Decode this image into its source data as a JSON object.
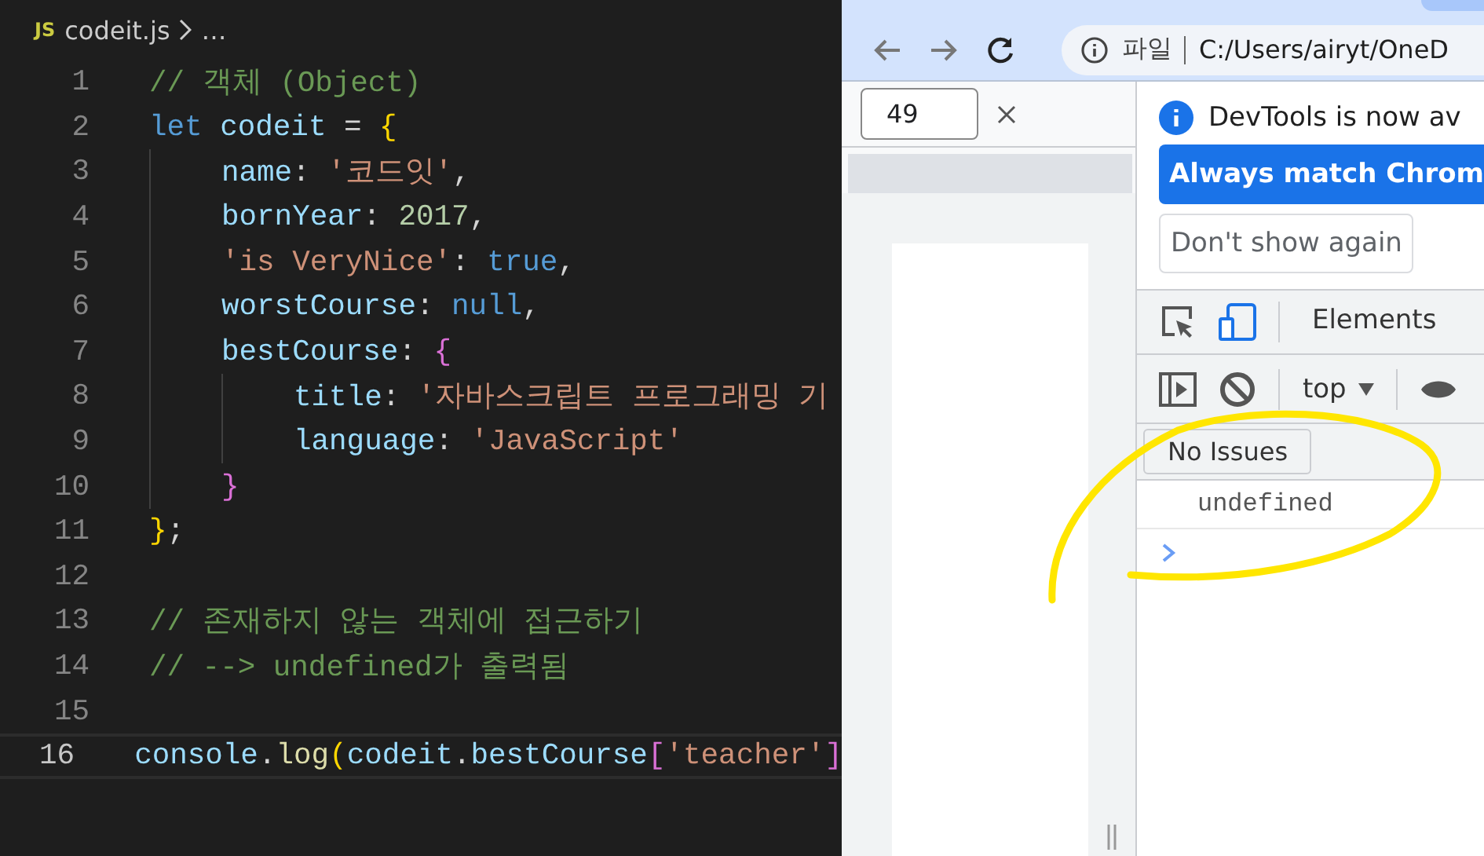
{
  "editor": {
    "breadcrumb": {
      "file_icon": "JS",
      "file": "codeit.js",
      "rest": "…"
    },
    "lines": [
      {
        "num": "1",
        "selected": false,
        "tokens": [
          {
            "t": "// 객체 (Object)",
            "kind": "comment"
          }
        ]
      },
      {
        "num": "2",
        "selected": false,
        "tokens": [
          {
            "t": "let ",
            "kind": "keyword"
          },
          {
            "t": "codeit",
            "kind": "variable"
          },
          {
            "t": " = ",
            "kind": "punct"
          },
          {
            "t": "{",
            "kind": "brace1"
          }
        ],
        "children": [
          {
            "num": "3",
            "selected": false,
            "tokens": [
              {
                "t": "name",
                "kind": "variable"
              },
              {
                "t": ": ",
                "kind": "punct"
              },
              {
                "t": "'코드잇'",
                "kind": "string"
              },
              {
                "t": ",",
                "kind": "punct"
              }
            ]
          },
          {
            "num": "4",
            "selected": false,
            "tokens": [
              {
                "t": "bornYear",
                "kind": "variable"
              },
              {
                "t": ": ",
                "kind": "punct"
              },
              {
                "t": "2017",
                "kind": "number"
              },
              {
                "t": ",",
                "kind": "punct"
              }
            ]
          },
          {
            "num": "5",
            "selected": false,
            "tokens": [
              {
                "t": "'is VeryNice'",
                "kind": "string"
              },
              {
                "t": ": ",
                "kind": "punct"
              },
              {
                "t": "true",
                "kind": "keyword"
              },
              {
                "t": ",",
                "kind": "punct"
              }
            ]
          },
          {
            "num": "6",
            "selected": false,
            "tokens": [
              {
                "t": "worstCourse",
                "kind": "variable"
              },
              {
                "t": ": ",
                "kind": "punct"
              },
              {
                "t": "null",
                "kind": "keyword"
              },
              {
                "t": ",",
                "kind": "punct"
              }
            ]
          },
          {
            "num": "7",
            "selected": false,
            "tokens": [
              {
                "t": "bestCourse",
                "kind": "variable"
              },
              {
                "t": ": ",
                "kind": "punct"
              },
              {
                "t": "{",
                "kind": "brace2"
              }
            ],
            "children": [
              {
                "num": "8",
                "selected": false,
                "tokens": [
                  {
                    "t": "title",
                    "kind": "variable"
                  },
                  {
                    "t": ": ",
                    "kind": "punct"
                  },
                  {
                    "t": "'자바스크립트 프로그래밍 기",
                    "kind": "string"
                  }
                ]
              },
              {
                "num": "9",
                "selected": false,
                "tokens": [
                  {
                    "t": "language",
                    "kind": "variable"
                  },
                  {
                    "t": ": ",
                    "kind": "punct"
                  },
                  {
                    "t": "'JavaScript'",
                    "kind": "string"
                  }
                ]
              }
            ]
          },
          {
            "num": "10",
            "selected": false,
            "tokens": [
              {
                "t": "}",
                "kind": "brace2"
              }
            ]
          }
        ]
      },
      {
        "num": "11",
        "selected": false,
        "tokens": [
          {
            "t": "}",
            "kind": "brace1"
          },
          {
            "t": ";",
            "kind": "punct"
          }
        ]
      },
      {
        "num": "12",
        "selected": false
      },
      {
        "num": "13",
        "selected": false,
        "tokens": [
          {
            "t": "// 존재하지 않는 객체에 접근하기",
            "kind": "comment"
          }
        ]
      },
      {
        "num": "14",
        "selected": false,
        "tokens": [
          {
            "t": "// --> undefined가 출력됨",
            "kind": "comment"
          }
        ]
      },
      {
        "num": "15",
        "selected": false
      },
      {
        "num": "16",
        "selected": true,
        "tokens": [
          {
            "t": "console",
            "kind": "variable"
          },
          {
            "t": ".",
            "kind": "punct"
          },
          {
            "t": "log",
            "kind": "function"
          },
          {
            "t": "(",
            "kind": "brace1"
          },
          {
            "t": "codeit",
            "kind": "variable"
          },
          {
            "t": ".",
            "kind": "punct"
          },
          {
            "t": "bestCourse",
            "kind": "variable"
          },
          {
            "t": "[",
            "kind": "brace2"
          },
          {
            "t": "'teacher'",
            "kind": "string"
          },
          {
            "t": "]",
            "kind": "brace2"
          }
        ]
      }
    ]
  },
  "browser": {
    "address": {
      "scheme": "파일",
      "url": "C:/Users/airyt/OneD"
    },
    "find_bar": {
      "value": "49"
    },
    "devtools": {
      "infobar": {
        "message": "DevTools is now av",
        "primary_button": "Always match Chrom",
        "secondary_button": "Don't show again"
      },
      "tabs": [
        {
          "label": "Elements",
          "selected": false
        }
      ],
      "context": "top",
      "issues_button": "No Issues",
      "console_output": [
        "undefined"
      ]
    }
  }
}
